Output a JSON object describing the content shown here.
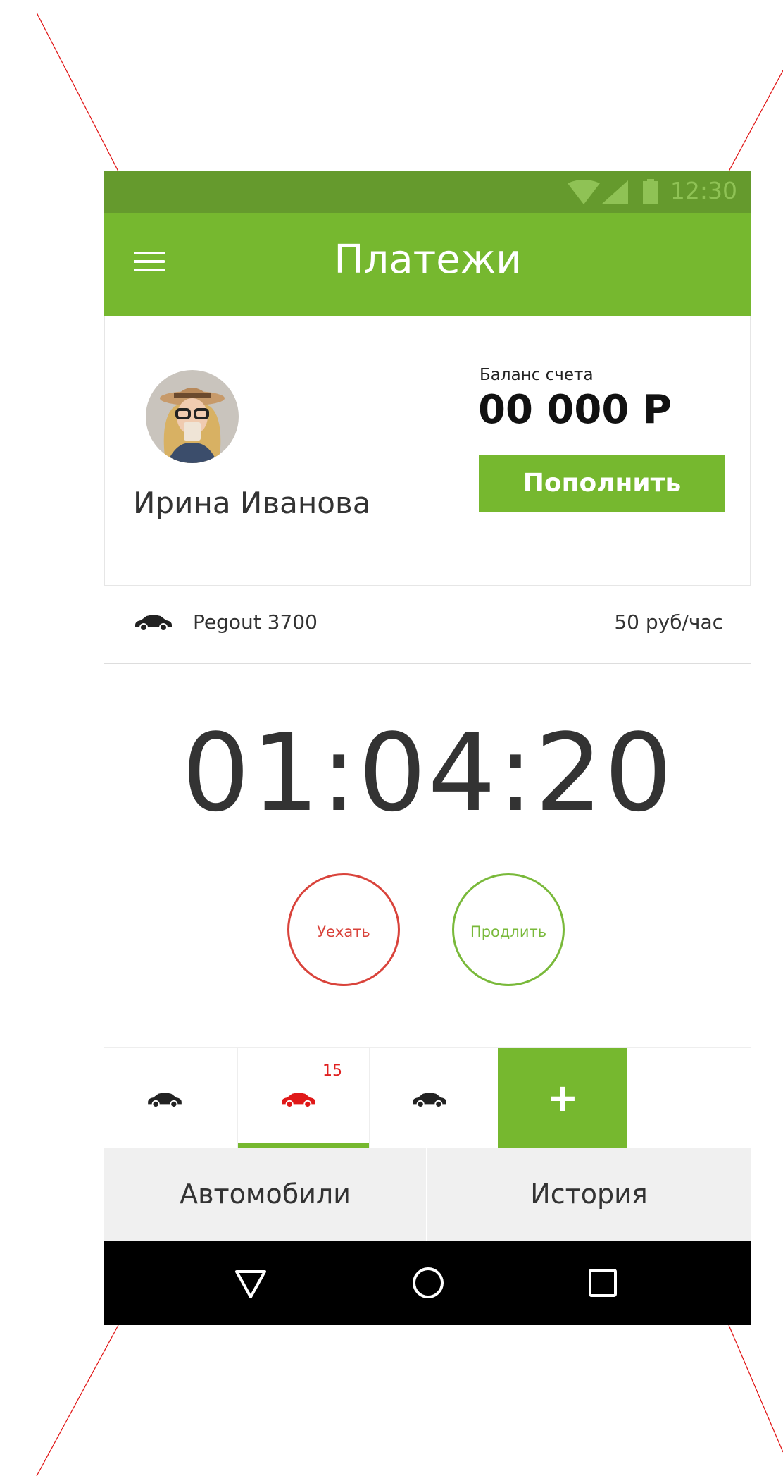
{
  "status_bar": {
    "time": "12:30"
  },
  "app_bar": {
    "title": "Платежи",
    "menu_icon": "hamburger-menu-icon"
  },
  "profile": {
    "user_name": "Ирина Иванова",
    "balance_label": "Баланс счета",
    "balance_value": "00 000 Р",
    "topup_label": "Пополнить"
  },
  "current_car": {
    "name": "Pegout 3700",
    "rate": "50 руб/час"
  },
  "timer": {
    "value": "01:04:20"
  },
  "actions": {
    "leave_label": "Уехать",
    "extend_label": "Продлить"
  },
  "car_tabs": {
    "badge": "15",
    "add_label": "+"
  },
  "bottom_tabs": {
    "cars_label": "Автомобили",
    "history_label": "История"
  },
  "colors": {
    "primary_green": "#76b82f",
    "status_green": "#659a2d",
    "alert_red": "#d9433b"
  }
}
